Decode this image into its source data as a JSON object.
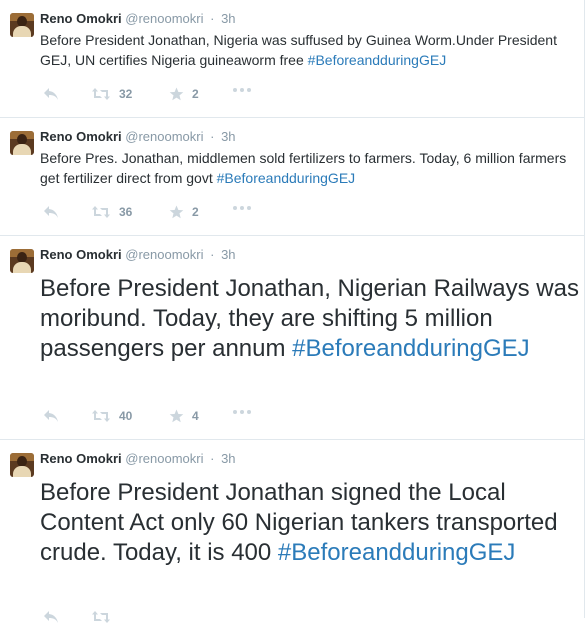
{
  "tweets": [
    {
      "name": "Reno Omokri",
      "handle": "@renoomokri",
      "time": "3h",
      "text_before": "Before President Jonathan, Nigeria was suffused by Guinea Worm.Under President GEJ, UN certifies Nigeria guineaworm free ",
      "hashtag": "#BeforeandduringGEJ",
      "retweets": "32",
      "favorites": "2"
    },
    {
      "name": "Reno Omokri",
      "handle": "@renoomokri",
      "time": "3h",
      "text_before": "Before Pres. Jonathan, middlemen sold fertilizers to farmers. Today, 6 million farmers get fertilizer direct from govt ",
      "hashtag": "#BeforeandduringGEJ",
      "retweets": "36",
      "favorites": "2"
    },
    {
      "name": "Reno Omokri",
      "handle": "@renoomokri",
      "time": "3h",
      "text_before": "Before President Jonathan, Nigerian Railways was moribund. Today, they are shifting 5 million passengers per annum ",
      "hashtag": "#BeforeandduringGEJ",
      "retweets": "40",
      "favorites": "4"
    },
    {
      "name": "Reno Omokri",
      "handle": "@renoomokri",
      "time": "3h",
      "text_before": "Before President Jonathan signed the Local Content Act only 60 Nigerian tankers transported crude. Today, it is 400 ",
      "hashtag": "#BeforeandduringGEJ",
      "retweets": "",
      "favorites": ""
    }
  ],
  "separator": "·",
  "icons": {
    "reply": "reply-icon",
    "retweet": "retweet-icon",
    "favorite": "star-icon",
    "more": "more-icon"
  },
  "colors": {
    "hashtag": "#2b7bb9",
    "muted": "#8899a6",
    "text": "#292f33",
    "divider": "#e1e8ed"
  }
}
